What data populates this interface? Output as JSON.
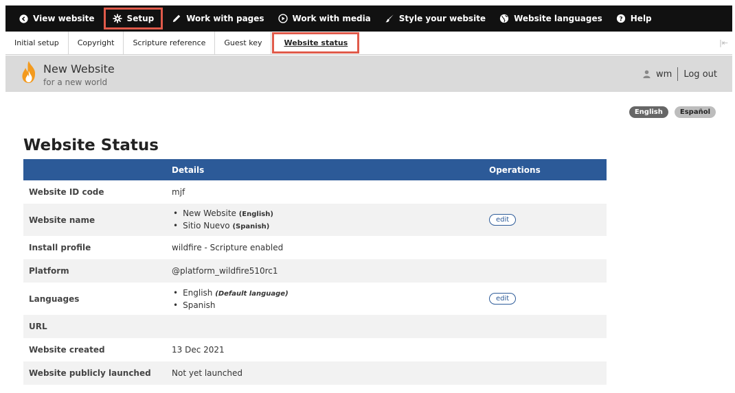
{
  "adminbar": {
    "items": [
      {
        "label": "View website",
        "icon": "chevron-left-circle-icon"
      },
      {
        "label": "Setup",
        "icon": "gear-icon"
      },
      {
        "label": "Work with pages",
        "icon": "pencil-icon"
      },
      {
        "label": "Work with media",
        "icon": "play-circle-icon"
      },
      {
        "label": "Style your website",
        "icon": "brush-icon"
      },
      {
        "label": "Website languages",
        "icon": "globe-icon"
      },
      {
        "label": "Help",
        "icon": "help-icon"
      }
    ]
  },
  "tabs": {
    "items": [
      {
        "label": "Initial setup"
      },
      {
        "label": "Copyright"
      },
      {
        "label": "Scripture reference"
      },
      {
        "label": "Guest key"
      },
      {
        "label": "Website status"
      }
    ],
    "collapse_icon": "|⇤"
  },
  "site": {
    "name": "New Website",
    "slogan": "for a new world",
    "logo_icon": "flame-icon"
  },
  "user": {
    "name": "wm",
    "logout": "Log out"
  },
  "languages": {
    "english": "English",
    "spanish": "Español"
  },
  "page": {
    "title": "Website Status"
  },
  "table": {
    "headers": [
      "",
      "Details",
      "Operations"
    ],
    "rows": {
      "id_code": {
        "label": "Website ID code",
        "value": "mjf"
      },
      "name": {
        "label": "Website name",
        "items": [
          {
            "text": "New Website",
            "tag": "(English)"
          },
          {
            "text": "Sitio Nuevo",
            "tag": "(Spanish)"
          }
        ],
        "op": "edit"
      },
      "profile": {
        "label": "Install profile",
        "value": "wildfire - Scripture enabled"
      },
      "platform": {
        "label": "Platform",
        "value": "@platform_wildfire510rc1"
      },
      "languages": {
        "label": "Languages",
        "items": [
          {
            "text": "English",
            "tag": "(Default language)"
          },
          {
            "text": "Spanish",
            "tag": ""
          }
        ],
        "op": "edit"
      },
      "url": {
        "label": "URL",
        "value": ""
      },
      "created": {
        "label": "Website created",
        "value": "13 Dec 2021"
      },
      "launched": {
        "label": "Website publicly launched",
        "value": "Not yet launched"
      }
    }
  },
  "colors": {
    "adminbar_bg": "#111111",
    "highlight": "#e05a4a",
    "table_header": "#2c5a98",
    "header_bg": "#dadada"
  }
}
